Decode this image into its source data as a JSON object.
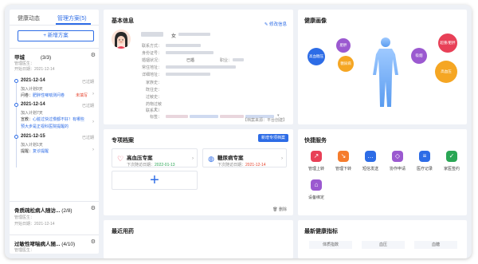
{
  "sidebar": {
    "tabs": [
      "健康动态",
      "管理方案(5)"
    ],
    "add_plan": "+ 新增方案",
    "plans": [
      {
        "name": "甲城",
        "count": "(3/3)",
        "manager": "管理医生：",
        "start": "开始日期：2021-12-14"
      },
      {
        "name": "骨质疏松病人随访...",
        "count": "(2/8)",
        "manager": "管理医生：",
        "start": "开始日期：2021-12-14"
      },
      {
        "name": "过敏性哮喘病人随...",
        "count": "(4/10)",
        "manager": "管理医生：",
        "start": ""
      }
    ],
    "timeline": [
      {
        "date": "2021-12-14",
        "status": "已过期",
        "sub": "加入计划0天",
        "items": [
          {
            "prefix": "问卷：",
            "text": "肥胖性哮喘测问卷",
            "warn": "未填写"
          }
        ]
      },
      {
        "date": "2021-12-14",
        "status": "已过期",
        "sub": "加入计划7天",
        "items": [
          {
            "prefix": "宣教：",
            "text": "心脏过快过慢都不好！有哪些",
            "warn": ""
          },
          {
            "prefix": "",
            "text": "预大步是正视科医院提醒的",
            "warn": ""
          }
        ]
      },
      {
        "date": "2021-12-15",
        "status": "已过期",
        "sub": "加入计划1天",
        "items": [
          {
            "prefix": "提醒：",
            "text": "复诊提醒",
            "warn": ""
          }
        ]
      }
    ]
  },
  "basic": {
    "title": "基本信息",
    "edit": "修改信息",
    "fields": [
      "联系方式：",
      "身份证号：",
      "婚姻状况：",
      "常住地址：",
      "详细地址：",
      "家族史：",
      "既往史：",
      "过敏史：",
      "药物过敏史：",
      "联系人：",
      "标签："
    ],
    "gender_age": "女",
    "marital_value": "已婚",
    "job_label": "职业：",
    "footer": "【档案来源：平台创建】"
  },
  "portrait": {
    "title": "健康画像",
    "bubbles": [
      {
        "label": "高血糖压",
        "color": "#2d6ce6"
      },
      {
        "label": "肥胖",
        "color": "#9b59d0"
      },
      {
        "label": "糖尿病",
        "color": "#f5a623"
      },
      {
        "label": "吸烟",
        "color": "#9b59d0"
      },
      {
        "label": "超重/肥胖",
        "color": "#e84057"
      },
      {
        "label": "高血压",
        "color": "#f5a623"
      }
    ]
  },
  "archives": {
    "title": "专项档案",
    "button": "新增专项档案",
    "cards": [
      {
        "name": "高血压专案",
        "next_label": "下次随访日期：",
        "next_date": "2022-01-13",
        "tone": "d"
      },
      {
        "name": "糖尿病专案",
        "next_label": "下次随访日期：",
        "next_date": "2021-12-14",
        "tone": "r"
      }
    ],
    "add": "+",
    "delete": "删除"
  },
  "services": {
    "title": "快捷服务",
    "items": [
      {
        "label": "管理上转",
        "color": "#e84057",
        "glyph": "↗"
      },
      {
        "label": "管理下转",
        "color": "#f57c2d",
        "glyph": "↘"
      },
      {
        "label": "短信发送",
        "color": "#2d6ce6",
        "glyph": "…"
      },
      {
        "label": "协作申请",
        "color": "#9b59d0",
        "glyph": "◇"
      },
      {
        "label": "医疗记录",
        "color": "#2d6ce6",
        "glyph": "≡"
      },
      {
        "label": "家医签约",
        "color": "#2aa655",
        "glyph": "✓"
      },
      {
        "label": "设备绑定",
        "color": "#9b59d0",
        "glyph": "⌂"
      }
    ]
  },
  "meds": {
    "title": "最近用药"
  },
  "indicators": {
    "title": "最新健康指标",
    "headers": [
      "体质指数",
      "血压",
      "血糖"
    ]
  }
}
